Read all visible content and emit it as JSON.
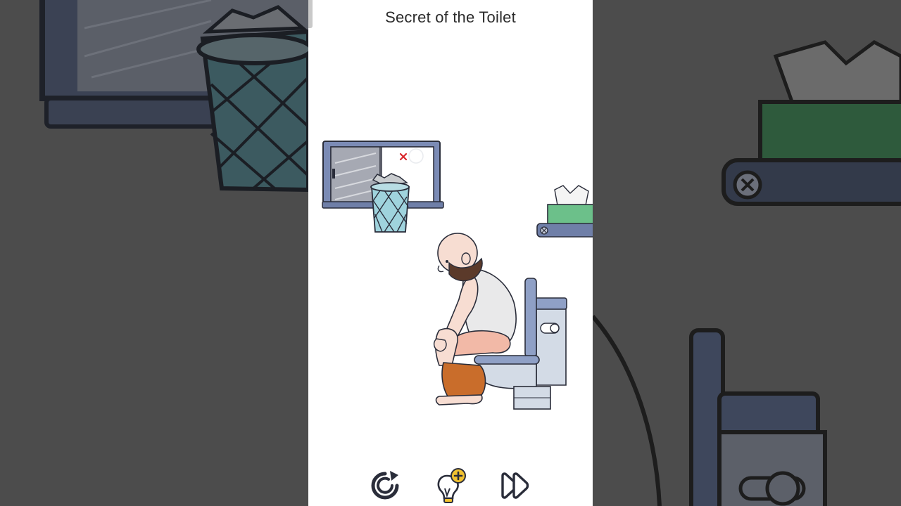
{
  "level": {
    "title": "Secret of the Toilet"
  },
  "scene_objects": {
    "window": "window",
    "trash_bin": "trash-bin",
    "hidden_mark": "red-x-mark",
    "tissue_box": "tissue-box",
    "shelf": "wall-shelf",
    "man": "bald-bearded-man",
    "toilet": "toilet"
  },
  "controls": {
    "restart_icon": "restart-icon",
    "hint_icon": "lightbulb-hint-icon",
    "skip_icon": "fast-forward-icon"
  },
  "colors": {
    "backdrop": "#4c4c4c",
    "panel": "#ffffff",
    "outline": "#2a2d3a",
    "frame_blue": "#6f7fa8",
    "toilet_body": "#d3dbe6",
    "tissue_green": "#6cc08a",
    "bin_teal": "#9fd3dd",
    "hint_gold": "#f2c230",
    "mark_red": "#d8262b"
  }
}
